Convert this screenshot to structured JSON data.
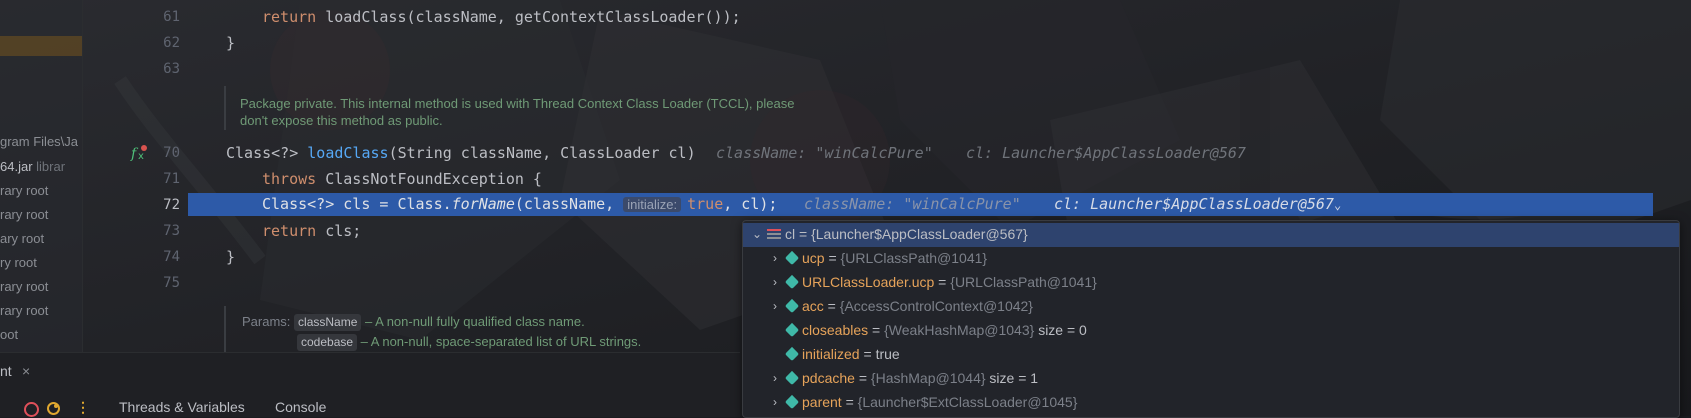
{
  "sidebar": {
    "items": [
      {
        "text": "gram Files\\Ja",
        "suffix": ""
      },
      {
        "text": "64.jar",
        "suffix": "librar"
      },
      {
        "text": "rary root",
        "suffix": ""
      },
      {
        "text": "rary root",
        "suffix": ""
      },
      {
        "text": "ary root",
        "suffix": ""
      },
      {
        "text": "ry root",
        "suffix": ""
      },
      {
        "text": "rary root",
        "suffix": ""
      },
      {
        "text": "rary root",
        "suffix": ""
      },
      {
        "text": "oot",
        "suffix": ""
      }
    ]
  },
  "editor": {
    "line_numbers": [
      "61",
      "62",
      "63",
      "70",
      "71",
      "72",
      "73",
      "74",
      "75"
    ],
    "line61": {
      "kw": "return",
      "fn": "loadClass",
      "rest": "(className, getContextClassLoader());"
    },
    "line62": "}",
    "doc1_line1": "Package private. This internal method is used with Thread Context Class Loader (TCCL), please",
    "doc1_line2": "don't expose this method as public.",
    "line70": {
      "a": "Class<?> ",
      "fn": "loadClass",
      "b": "(String className, ClassLoader cl)"
    },
    "line70_hint1": "className: \"winCalcPure\"",
    "line70_hint2": "cl: Launcher$AppClassLoader@567",
    "line71": {
      "kw": "throws",
      "rest": " ClassNotFoundException {"
    },
    "line72": {
      "a": "Class<?> cls = Class.",
      "fn": "forName",
      "b": "(className, ",
      "inlay": "initialize:",
      "kw": "true",
      "c": ", cl);"
    },
    "line72_hint1": "className: \"winCalcPure\"",
    "line72_hint2": "cl: Launcher$AppClassLoader@567",
    "line72_chevron": "⌄",
    "line73": {
      "kw": "return",
      "rest": " cls;"
    },
    "line74": "}",
    "doc2_label": "Params:",
    "doc2_p1": "className",
    "doc2_p1_desc": " – A non-null fully qualified class name.",
    "doc2_p2": "codebase",
    "doc2_p2_desc": " – A non-null, space-separated list of URL strings."
  },
  "variables": {
    "root": {
      "name": "cl",
      "op": " = ",
      "value": "{Launcher$AppClassLoader@567}"
    },
    "children": [
      {
        "name": "ucp",
        "value": "{URLClassPath@1041}",
        "extra": "",
        "expandable": true
      },
      {
        "name": "URLClassLoader.ucp",
        "value": "{URLClassPath@1041}",
        "extra": "",
        "expandable": true
      },
      {
        "name": "acc",
        "value": "{AccessControlContext@1042}",
        "extra": "",
        "expandable": true
      },
      {
        "name": "closeables",
        "value": "{WeakHashMap@1043}",
        "extra": "size = 0",
        "expandable": false
      },
      {
        "name": "initialized",
        "value": "",
        "plain": "true",
        "extra": "",
        "expandable": false
      },
      {
        "name": "pdcache",
        "value": "{HashMap@1044}",
        "extra": "size = 1",
        "expandable": true
      },
      {
        "name": "parent",
        "value": "{Launcher$ExtClassLoader@1045}",
        "extra": "",
        "expandable": true
      }
    ]
  },
  "debug_panel": {
    "tab_title_fragment": "nt",
    "close_glyph": "×",
    "tabs": [
      "Threads & Variables",
      "Console"
    ],
    "more_glyph": "⋮"
  },
  "colors": {
    "keyword": "#cf8e6d",
    "function": "#56a8f5",
    "current_line": "#2d5aa8",
    "field_name": "#e6a35a",
    "field_icon": "#3fb9a8"
  }
}
